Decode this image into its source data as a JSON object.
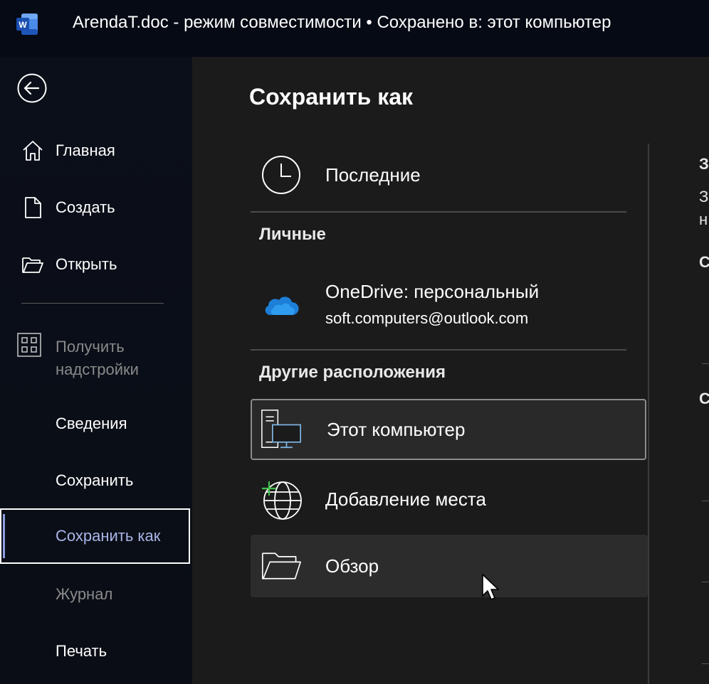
{
  "titlebar": {
    "app_icon": "word-icon",
    "title": "ArendaT.doc  -  режим совместимости • Сохранено в: этот компьютер"
  },
  "sidebar": {
    "back_icon": "back-arrow-icon",
    "items": [
      {
        "label": "Главная",
        "icon": "home-icon"
      },
      {
        "label": "Создать",
        "icon": "new-document-icon"
      },
      {
        "label": "Открыть",
        "icon": "open-folder-icon"
      },
      {
        "label": "Получить надстройки",
        "icon": "addins-grid-icon",
        "state": "disabled"
      },
      {
        "label": "Сведения"
      },
      {
        "label": "Сохранить"
      },
      {
        "label": "Сохранить как",
        "state": "active"
      },
      {
        "label": "Журнал",
        "state": "disabled"
      },
      {
        "label": "Печать"
      }
    ]
  },
  "main": {
    "title": "Сохранить как",
    "recent": {
      "label": "Последние",
      "icon": "clock-icon"
    },
    "personal_header": "Личные",
    "onedrive": {
      "label": "OneDrive: персональный",
      "account": "soft.computers@outlook.com",
      "icon": "onedrive-cloud-icon"
    },
    "other_header": "Другие расположения",
    "this_pc": {
      "label": "Этот компьютер",
      "icon": "computer-icon",
      "state": "selected"
    },
    "add_place": {
      "label": "Добавление места",
      "icon": "globe-add-icon"
    },
    "browse": {
      "label": "Обзор",
      "icon": "folder-icon",
      "state": "hover"
    }
  },
  "right_panel_clipped": {
    "chars": [
      "З",
      "З",
      "н",
      "С",
      "С"
    ]
  },
  "colors": {
    "titlebar_bg": "#050a14",
    "sidebar_bg": "#0b0f1a",
    "main_bg": "#1b1b1b",
    "active_text": "#a9b6e8",
    "onedrive_blue": "#1e7fd8",
    "pc_screen_blue": "#7fb8e6",
    "add_green": "#3fbf4a"
  }
}
